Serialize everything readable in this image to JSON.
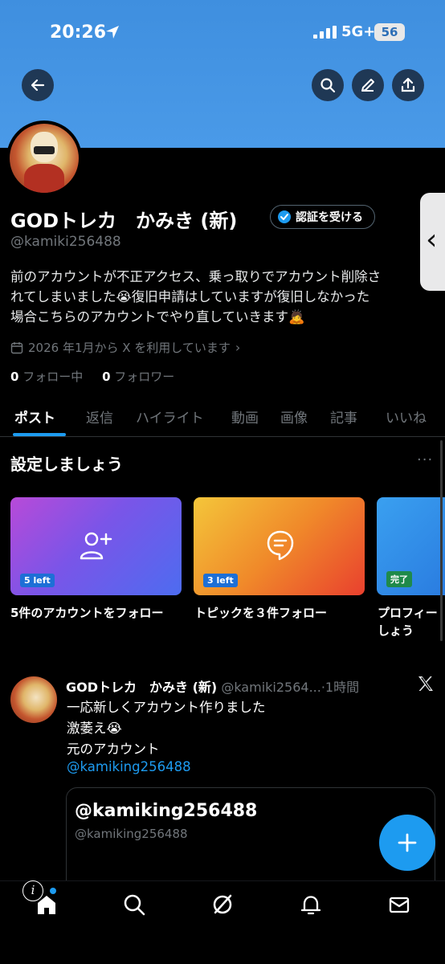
{
  "status_bar": {
    "time": "20:26",
    "network": "5G+",
    "battery": "56"
  },
  "profile": {
    "name": "GODトレカ　かみき (新)",
    "verify_button": "認証を受ける",
    "handle": "@kamiki256488",
    "bio": "前のアカウントが不正アクセス、乗っ取りでアカウント削除さ\nれてしまいました😭復旧申請はしていますが復旧しなかった\n場合こちらのアカウントでやり直していきます🙇",
    "joined": "2026 年1月から X を利用しています",
    "following_count": "0",
    "following_label": "フォロー中",
    "followers_count": "0",
    "followers_label": "フォロワー"
  },
  "tabs": [
    "ポスト",
    "返信",
    "ハイライト",
    "動画",
    "画像",
    "記事",
    "いいね"
  ],
  "setup": {
    "title": "設定しましょう",
    "cards": [
      {
        "badge": "5 left",
        "label": "5件のアカウントをフォロー"
      },
      {
        "badge": "3 left",
        "label": "トピックを３件フォロー"
      },
      {
        "badge": "完了",
        "label": "プロフィー",
        "label2": "しょう"
      }
    ]
  },
  "post": {
    "name": "GODトレカ　かみき (新)",
    "handle_time": "@kamiki2564...·1時間",
    "text": "一応新しくアカウント作りました\n激萎え😭\n元のアカウント",
    "mention": "@kamiking256488",
    "quote_name": "@kamiking256488",
    "quote_handle": "@kamiking256488"
  },
  "colors": {
    "accent": "#1d9bf0",
    "banner": "#4a9ae8",
    "background": "#000000"
  }
}
